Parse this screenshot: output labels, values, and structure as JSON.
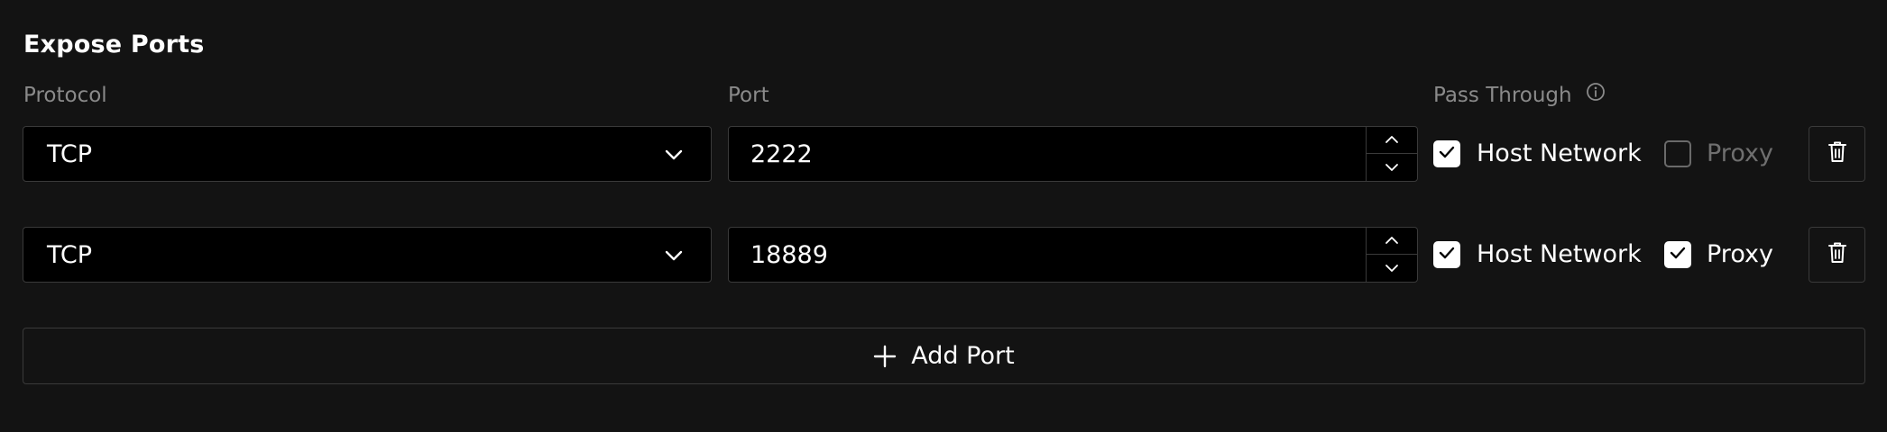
{
  "section": {
    "title": "Expose Ports"
  },
  "columns": {
    "protocol": "Protocol",
    "port": "Port",
    "pass_through": "Pass Through"
  },
  "rows": [
    {
      "protocol": "TCP",
      "port": "2222",
      "host_network": {
        "label": "Host Network",
        "checked": true
      },
      "proxy": {
        "label": "Proxy",
        "checked": false
      }
    },
    {
      "protocol": "TCP",
      "port": "18889",
      "host_network": {
        "label": "Host Network",
        "checked": true
      },
      "proxy": {
        "label": "Proxy",
        "checked": true
      }
    }
  ],
  "actions": {
    "add_port": "Add Port"
  },
  "icons": {
    "info": "info-icon",
    "chevron": "chevron-down-icon",
    "stepper_up": "chevron-up-icon",
    "stepper_down": "chevron-down-icon",
    "check": "check-icon",
    "delete": "trash-icon",
    "add": "plus-icon"
  },
  "colors": {
    "background": "#131313",
    "input_background": "#000000",
    "border": "#3a3a3a",
    "label": "#8a8a8a",
    "text": "#ffffff",
    "disabled_text": "#6f6f6f"
  }
}
